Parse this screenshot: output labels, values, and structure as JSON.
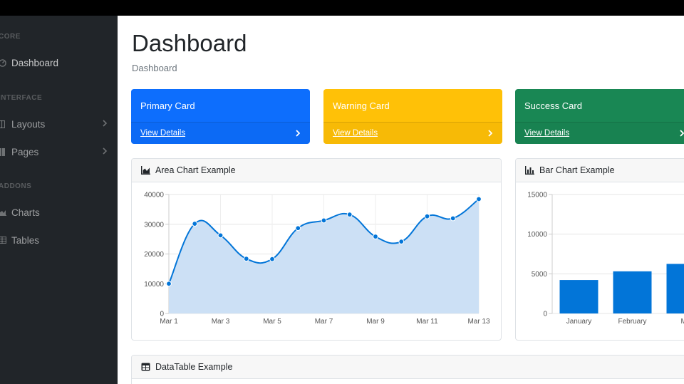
{
  "sidebar": {
    "headings": [
      "CORE",
      "INTERFACE",
      "ADDONS"
    ],
    "items": [
      {
        "label": "Dashboard",
        "icon": "tachometer-icon"
      },
      {
        "label": "Layouts",
        "icon": "columns-icon"
      },
      {
        "label": "Pages",
        "icon": "book-icon"
      },
      {
        "label": "Charts",
        "icon": "chart-area-icon"
      },
      {
        "label": "Tables",
        "icon": "table-icon"
      }
    ]
  },
  "main": {
    "title": "Dashboard",
    "breadcrumb": "Dashboard"
  },
  "cards": [
    {
      "title": "Primary Card",
      "link": "View Details",
      "color": "#0d6efd"
    },
    {
      "title": "Warning Card",
      "link": "View Details",
      "color": "#ffc107"
    },
    {
      "title": "Success Card",
      "link": "View Details",
      "color": "#198754"
    }
  ],
  "area_card": {
    "title": "Area Chart Example"
  },
  "bar_card": {
    "title": "Bar Chart Example"
  },
  "table_card": {
    "title": "DataTable Example"
  },
  "chart_data": [
    {
      "type": "area",
      "title": "",
      "x": [
        "Mar 1",
        "Mar 2",
        "Mar 3",
        "Mar 4",
        "Mar 5",
        "Mar 6",
        "Mar 7",
        "Mar 8",
        "Mar 9",
        "Mar 10",
        "Mar 11",
        "Mar 12",
        "Mar 13"
      ],
      "x_tick_labels": [
        "Mar 1",
        "Mar 3",
        "Mar 5",
        "Mar 7",
        "Mar 9",
        "Mar 11",
        "Mar 13"
      ],
      "values": [
        10000,
        30162,
        26263,
        18394,
        18287,
        28682,
        31274,
        33259,
        25849,
        24159,
        32651,
        31984,
        38451
      ],
      "ylim": [
        0,
        40000
      ],
      "y_ticks": [
        "40000",
        "30000",
        "20000",
        "10000",
        "0"
      ],
      "grid": true,
      "line_color": "#0275d8",
      "fill_color": "#cce0f5"
    },
    {
      "type": "bar",
      "title": "",
      "categories": [
        "January",
        "February",
        "Ma"
      ],
      "values": [
        4215,
        5312,
        6251
      ],
      "ylim": [
        0,
        15000
      ],
      "y_ticks": [
        "15000",
        "10000",
        "5000",
        "0"
      ],
      "grid": true,
      "bar_color": "#0275d8"
    }
  ]
}
